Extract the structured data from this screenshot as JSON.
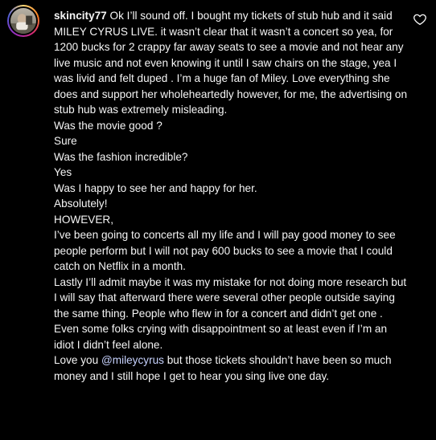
{
  "comment": {
    "username": "skincity77",
    "text_before_mention": " Ok I’ll sound off. I bought my tickets of stub hub and it said MILEY CYRUS LIVE. it wasn’t clear that it wasn’t a concert so yea, for 1200 bucks for 2 crappy far away seats to see a movie and not hear any live music and not even knowing it until I saw chairs on the stage, yea I was livid and felt duped . I’m a huge fan of Miley. Love everything she does and support her wholeheartedly however, for me, the advertising on stub hub was extremely misleading.\nWas the movie good ?\nSure\nWas the fashion incredible?\nYes\nWas I happy to see her and happy for her.\nAbsolutely!\nHOWEVER,\nI’ve been going to concerts all my life and I will pay good money to see people perform but I will not pay 600 bucks to see a movie that I could catch on Netflix in a month.\nLastly I’ll admit maybe it was my mistake for not doing more research but I will say that afterward there were several other people outside saying the same thing. People who flew in for a concert and didn’t get one . Even some folks crying with disappointment so at least even if I’m an idiot I didn’t feel alone.\nLove you ",
    "mention": "@mileycyrus",
    "text_after_mention": " but those tickets shouldn’t have been so much money and I still hope I get to hear you sing live one day."
  },
  "icons": {
    "like": "heart-outline-icon",
    "avatar": "profile-avatar"
  },
  "colors": {
    "background": "#000000",
    "text": "#f5f5f5",
    "mention": "#c7d2fe"
  }
}
